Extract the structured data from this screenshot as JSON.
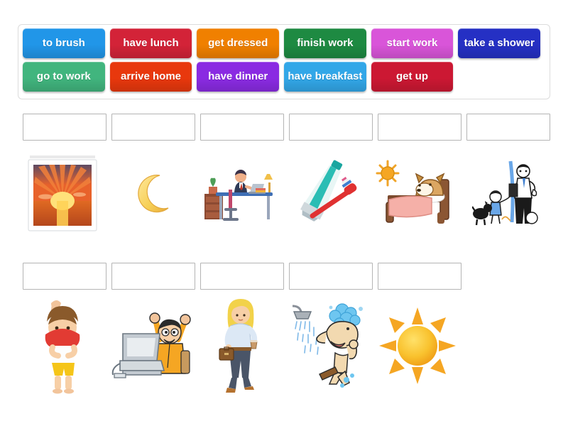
{
  "activity": {
    "type": "match-up",
    "wordbank": {
      "rows": [
        [
          {
            "label": "to brush",
            "color": "#2196e8",
            "icon": "word-tile"
          },
          {
            "label": "have lunch",
            "color": "#d32338",
            "icon": "word-tile"
          },
          {
            "label": "get dressed",
            "color": "#f08000",
            "icon": "word-tile"
          },
          {
            "label": "finish work",
            "color": "#1e8a42",
            "icon": "word-tile"
          },
          {
            "label": "start work",
            "color": "#d955d9",
            "icon": "word-tile"
          },
          {
            "label": "take a shower",
            "color": "#2530c4",
            "icon": "word-tile"
          }
        ],
        [
          {
            "label": "go to work",
            "color": "#41b57e",
            "icon": "word-tile"
          },
          {
            "label": "arrive home",
            "color": "#e8380d",
            "icon": "word-tile"
          },
          {
            "label": "have dinner",
            "color": "#8a2be2",
            "icon": "word-tile"
          },
          {
            "label": "have breakfast",
            "color": "#32a7e8",
            "icon": "word-tile"
          },
          {
            "label": "get up",
            "color": "#cc1833",
            "icon": "word-tile"
          },
          {
            "label": "",
            "color": "transparent",
            "icon": "word-tile-empty"
          }
        ]
      ]
    },
    "rows": [
      {
        "slots": [
          "",
          "",
          "",
          "",
          "",
          ""
        ],
        "pictures": [
          {
            "name": "sunrise-photo-image",
            "alt": "framed photo of sunrise over the sea"
          },
          {
            "name": "crescent-moon-image",
            "alt": "yellow crescent moon"
          },
          {
            "name": "office-worker-desk-image",
            "alt": "man working at office desk with laptop and lamp"
          },
          {
            "name": "toothpaste-toothbrush-image",
            "alt": "tube of toothpaste and red toothbrush"
          },
          {
            "name": "dog-waking-in-bed-image",
            "alt": "dog waking up in bed with sun shining"
          },
          {
            "name": "man-arriving-home-image",
            "alt": "man arriving home greeted by child and dog"
          }
        ]
      },
      {
        "slots": [
          "",
          "",
          "",
          "",
          ""
        ],
        "pictures": [
          {
            "name": "boy-putting-on-shirt-image",
            "alt": "boy pulling a red shirt over his head"
          },
          {
            "name": "man-cheering-at-computer-image",
            "alt": "man cheering with arms up behind a computer"
          },
          {
            "name": "woman-walking-to-work-image",
            "alt": "blonde woman with briefcase and coffee walking"
          },
          {
            "name": "man-in-shower-image",
            "alt": "man washing his hair under a shower head"
          },
          {
            "name": "sun-image",
            "alt": "bright yellow sun with rays"
          }
        ]
      }
    ]
  }
}
